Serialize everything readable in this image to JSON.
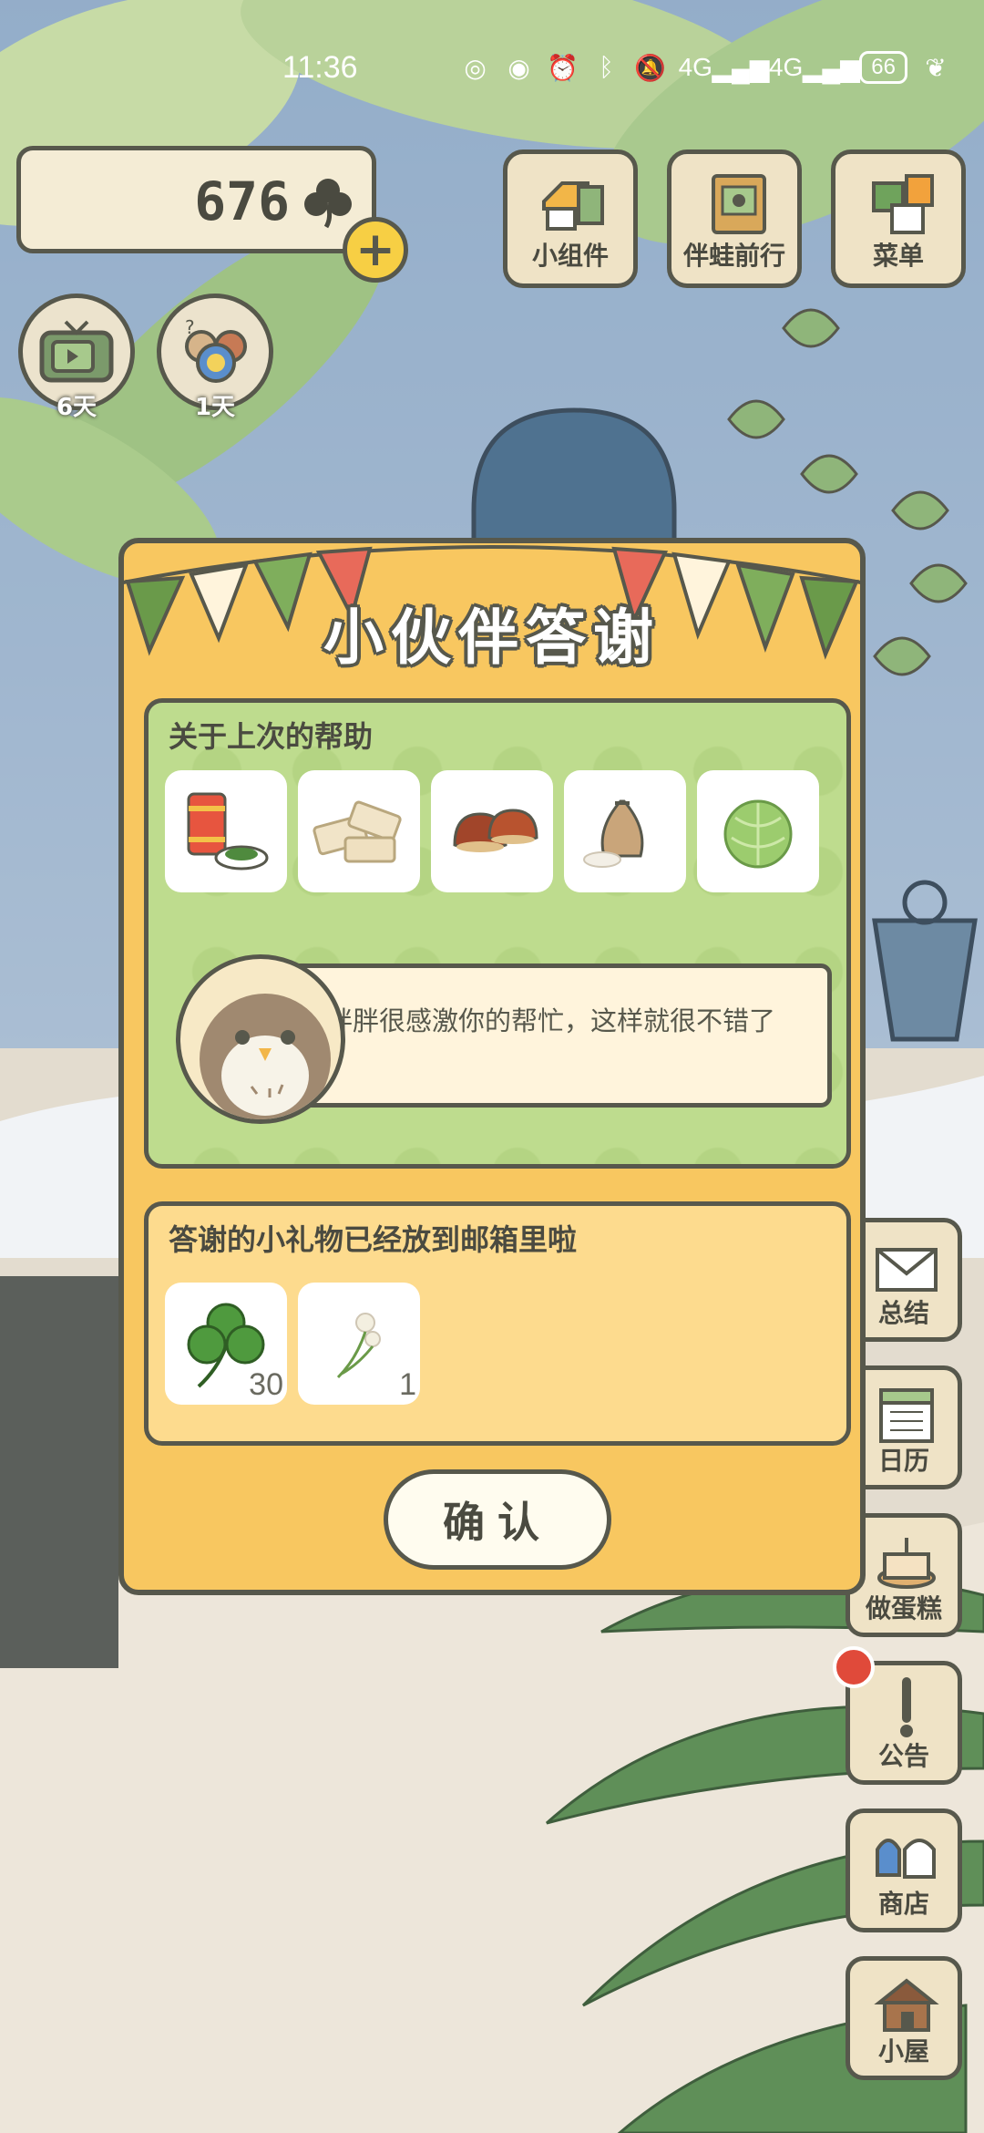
{
  "status_bar": {
    "time": "11:36",
    "network_1": "4G",
    "network_2": "4G",
    "battery": "66"
  },
  "currency": {
    "value": "676",
    "icon": "clover-icon"
  },
  "round_buttons": [
    {
      "name": "tv",
      "label": "6天"
    },
    {
      "name": "visitors",
      "label": "1天"
    }
  ],
  "top_menu": [
    {
      "label": "小组件",
      "icon": "widget-icon"
    },
    {
      "label": "伴蛙前行",
      "icon": "book-icon"
    },
    {
      "label": "菜单",
      "icon": "menu-cards-icon"
    }
  ],
  "side_menu": [
    {
      "label": "总结",
      "icon": "mail-icon"
    },
    {
      "label": "日历",
      "icon": "calendar-icon"
    },
    {
      "label": "做蛋糕",
      "icon": "cake-icon"
    },
    {
      "label": "公告",
      "icon": "exclamation-icon"
    },
    {
      "label": "商店",
      "icon": "shop-bags-icon"
    },
    {
      "label": "小屋",
      "icon": "house-icon"
    }
  ],
  "dialog": {
    "title": "小伙伴答谢",
    "help_heading": "关于上次的帮助",
    "help_items": [
      "tin-and-seaweed-icon",
      "nougat-icon",
      "chestnut-icon",
      "rice-sack-icon",
      "cabbage-icon"
    ],
    "speech": "胖胖很感激你的帮忙，这样就很不错了",
    "gift_heading": "答谢的小礼物已经放到邮箱里啦",
    "gifts": [
      {
        "icon": "clover-icon",
        "count": "30"
      },
      {
        "icon": "dandelion-icon",
        "count": "1"
      }
    ],
    "confirm_label": "确认"
  },
  "colors": {
    "dialog_bg": "#f8c760",
    "help_panel_bg": "#bedc8e",
    "gift_panel_bg": "#fddb8e",
    "outline": "#57584c"
  }
}
